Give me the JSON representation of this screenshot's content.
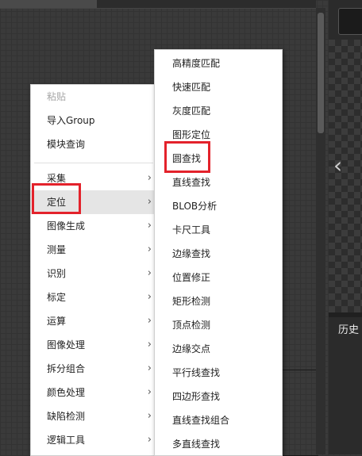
{
  "main_menu": {
    "top_items": [
      {
        "label": "粘贴",
        "disabled": true
      },
      {
        "label": "导入Group",
        "disabled": false
      },
      {
        "label": "模块查询",
        "disabled": false
      }
    ],
    "categories": [
      {
        "label": "采集"
      },
      {
        "label": "定位",
        "highlighted": true
      },
      {
        "label": "图像生成"
      },
      {
        "label": "测量"
      },
      {
        "label": "识别"
      },
      {
        "label": "标定"
      },
      {
        "label": "运算"
      },
      {
        "label": "图像处理"
      },
      {
        "label": "拆分组合"
      },
      {
        "label": "颜色处理"
      },
      {
        "label": "缺陷检测"
      },
      {
        "label": "逻辑工具"
      }
    ],
    "submenu_chevron": "›"
  },
  "submenu": {
    "items": [
      {
        "label": "高精度匹配"
      },
      {
        "label": "快速匹配"
      },
      {
        "label": "灰度匹配"
      },
      {
        "label": "图形定位"
      },
      {
        "label": "圆查找",
        "boxed": true
      },
      {
        "label": "直线查找"
      },
      {
        "label": "BLOB分析"
      },
      {
        "label": "卡尺工具"
      },
      {
        "label": "边缘查找"
      },
      {
        "label": "位置修正"
      },
      {
        "label": "矩形检测"
      },
      {
        "label": "顶点检测"
      },
      {
        "label": "边缘交点"
      },
      {
        "label": "平行线查找"
      },
      {
        "label": "四边形查找"
      },
      {
        "label": "直线查找组合"
      },
      {
        "label": "多直线查找"
      }
    ]
  },
  "right_panel": {
    "history_label": "历史",
    "nav_arrow": "‹"
  },
  "colors": {
    "highlight_box": "#e3222b",
    "menu_hover": "#e5e5e5",
    "canvas_bg": "#3a3a3a"
  }
}
